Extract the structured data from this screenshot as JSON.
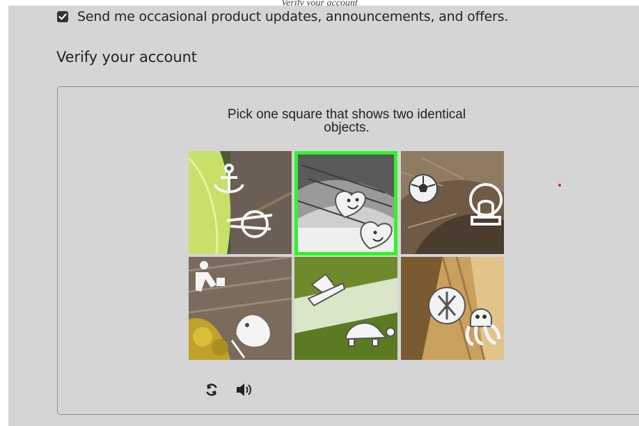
{
  "header": {
    "caption": "Verify your account"
  },
  "consent": {
    "checked": true,
    "label": "Send me occasional product updates, announcements, and offers."
  },
  "verify": {
    "heading": "Verify your account"
  },
  "captcha": {
    "prompt_line1": "Pick one square that shows two identical",
    "prompt_line2": "objects.",
    "selected_index": 1,
    "tiles": [
      {
        "icons": [
          "anchor-icon",
          "scissors-icon"
        ]
      },
      {
        "icons": [
          "smiling-heart-icon",
          "smiling-heart-icon"
        ]
      },
      {
        "icons": [
          "soccer-ball-icon",
          "stamp-icon"
        ]
      },
      {
        "icons": [
          "runner-icon",
          "bird-icon"
        ]
      },
      {
        "icons": [
          "hat-icon",
          "turtle-icon"
        ]
      },
      {
        "icons": [
          "crossed-circle-icon",
          "octopus-icon"
        ]
      }
    ],
    "controls": [
      "refresh-icon",
      "audio-icon"
    ],
    "selection_color": "#2ef52b"
  }
}
